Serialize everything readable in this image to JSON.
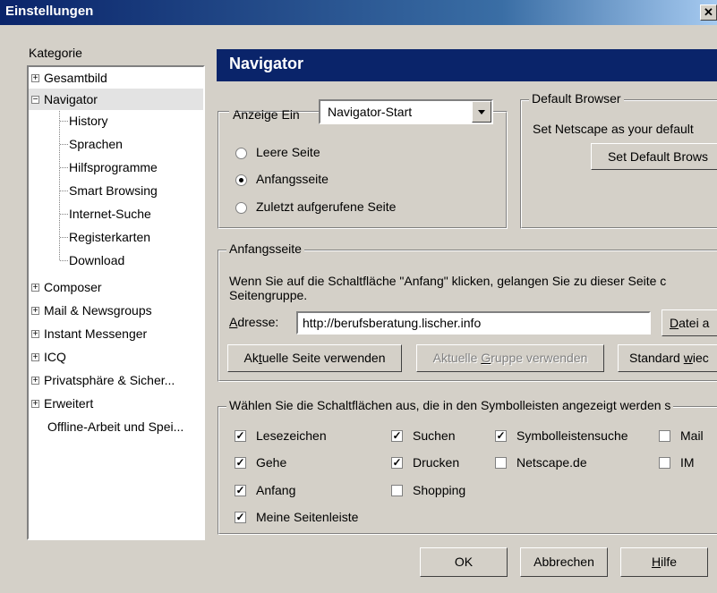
{
  "window": {
    "title": "Einstellungen",
    "close": "✕"
  },
  "sidebar": {
    "label": "Kategorie",
    "items": [
      {
        "label": "Gesamtbild",
        "expander": "+"
      },
      {
        "label": "Navigator",
        "expander": "−"
      },
      {
        "label": "History"
      },
      {
        "label": "Sprachen"
      },
      {
        "label": "Hilfsprogramme"
      },
      {
        "label": "Smart Browsing"
      },
      {
        "label": "Internet-Suche"
      },
      {
        "label": "Registerkarten"
      },
      {
        "label": "Download"
      },
      {
        "label": "Composer",
        "expander": "+"
      },
      {
        "label": "Mail & Newsgroups",
        "expander": "+"
      },
      {
        "label": "Instant Messenger",
        "expander": "+"
      },
      {
        "label": "ICQ",
        "expander": "+"
      },
      {
        "label": "Privatsphäre & Sicher...",
        "expander": "+"
      },
      {
        "label": "Erweitert",
        "expander": "+"
      },
      {
        "label": "Offline-Arbeit und Spei..."
      }
    ]
  },
  "panel": {
    "title": "Navigator",
    "display": {
      "label": "Anzeige Ein",
      "select_value": "Navigator-Start",
      "options": [
        "Leere Seite",
        "Anfangsseite",
        "Zuletzt aufgerufene Seite"
      ],
      "selected": 1
    },
    "default_browser": {
      "label": "Default Browser",
      "text": "Set Netscape as your default",
      "button": "Set Default Brows"
    },
    "homepage": {
      "label": "Anfangsseite",
      "desc_line1": "Wenn Sie auf die Schaltfläche \"Anfang\" klicken, gelangen Sie zu dieser Seite c",
      "desc_line2": "Seitengruppe.",
      "address_label_pre": "A",
      "address_label_post": "dresse:",
      "address_value": "http://berufsberatung.lischer.info",
      "file_btn_pre": "D",
      "file_btn_post": "atei a",
      "btn_current_pre": "Ak",
      "btn_current_u": "t",
      "btn_current_post": "uelle Seite verwenden",
      "btn_group_pre": "Aktuelle ",
      "btn_group_u": "G",
      "btn_group_post": "ruppe verwenden",
      "btn_default_pre": "Standard ",
      "btn_default_u": "w",
      "btn_default_post": "iec"
    },
    "toolbar_buttons": {
      "label": "Wählen Sie die Schaltflächen aus, die in den Symbolleisten angezeigt werden s",
      "checkmark": "✓",
      "items": [
        {
          "label": "Lesezeichen",
          "checked": true
        },
        {
          "label": "Suchen",
          "checked": true
        },
        {
          "label": "Symbolleistensuche",
          "checked": true
        },
        {
          "label": "Mail",
          "checked": false
        },
        {
          "label": "Gehe",
          "checked": true
        },
        {
          "label": "Drucken",
          "checked": true
        },
        {
          "label": "Netscape.de",
          "checked": false
        },
        {
          "label": "IM",
          "checked": false
        },
        {
          "label": "Anfang",
          "checked": true
        },
        {
          "label": "Shopping",
          "checked": false
        },
        {
          "label": "Meine Seitenleiste",
          "checked": true
        }
      ]
    }
  },
  "footer": {
    "ok": "OK",
    "cancel": "Abbrechen",
    "help_u": "H",
    "help_post": "ilfe"
  }
}
